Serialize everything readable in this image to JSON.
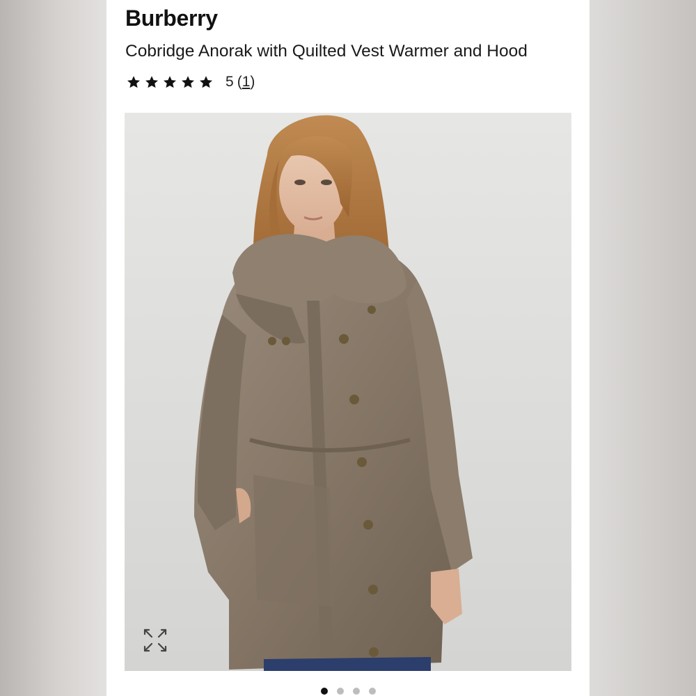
{
  "product": {
    "brand": "Burberry",
    "title": "Cobridge Anorak with Quilted Vest Warmer and Hood",
    "rating": {
      "stars": 5,
      "max_stars": 5,
      "value_label": "5",
      "count_open": "(",
      "count": "1",
      "count_close": ")"
    },
    "image": {
      "alt": "Model wearing a taupe Burberry anorak with hood and drawstring waist",
      "expand_icon": "expand-arrows-icon"
    },
    "carousel": {
      "total": 4,
      "active_index": 0
    }
  },
  "colors": {
    "star": "#111111",
    "jacket": "#8a7b6c",
    "hair": "#b0773f",
    "background_photo": "#e2e2e0",
    "dot_active": "#111111",
    "dot_inactive": "#bdbdbd"
  }
}
